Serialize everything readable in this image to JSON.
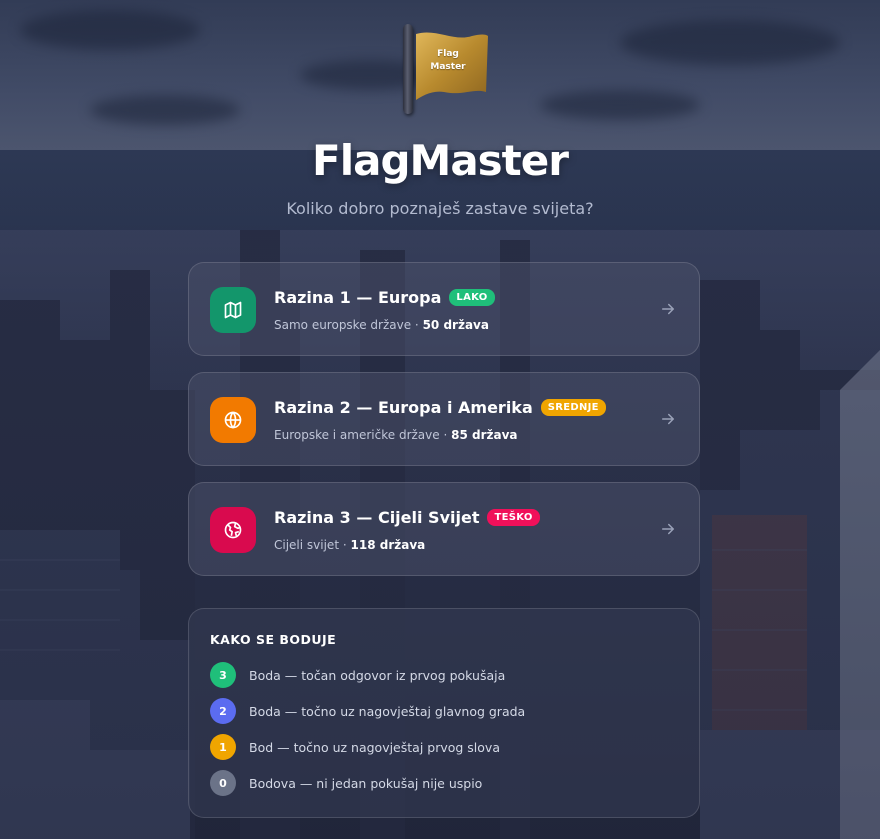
{
  "logo": {
    "line1": "Flag",
    "line2": "Master",
    "accent": "#c99a3a"
  },
  "header": {
    "title": "FlagMaster",
    "subtitle": "Koliko dobro poznaješ zastave svijeta?"
  },
  "levels": [
    {
      "title": "Razina 1 — Europa",
      "badge": "LAKO",
      "badge_color": "#1fbf7a",
      "icon": "map-icon",
      "icon_color": "#13966b",
      "description": "Samo europske države",
      "separator": "·",
      "count": "50 država"
    },
    {
      "title": "Razina 2 — Europa i Amerika",
      "badge": "SREDNJE",
      "badge_color": "#f0a500",
      "icon": "globe-icon",
      "icon_color": "#f27a00",
      "description": "Europske i američke države",
      "separator": "·",
      "count": "85 država"
    },
    {
      "title": "Razina 3 — Cijeli Svijet",
      "badge": "TEŠKO",
      "badge_color": "#f0105a",
      "icon": "earth-icon",
      "icon_color": "#d90a4e",
      "description": "Cijeli svijet",
      "separator": "·",
      "count": "118 država"
    }
  ],
  "scoring": {
    "title": "KAKO SE BODUJE",
    "rules": [
      {
        "points": "3",
        "text": "Boda — točan odgovor iz prvog pokušaja",
        "color": "#1fbf7a"
      },
      {
        "points": "2",
        "text": "Boda — točno uz nagovještaj glavnog grada",
        "color": "#5b6cf0"
      },
      {
        "points": "1",
        "text": "Bod — točno uz nagovještaj prvog slova",
        "color": "#f0a500"
      },
      {
        "points": "0",
        "text": "Bodova — ni jedan pokušaj nije uspio",
        "color": "#6b7388"
      }
    ]
  }
}
